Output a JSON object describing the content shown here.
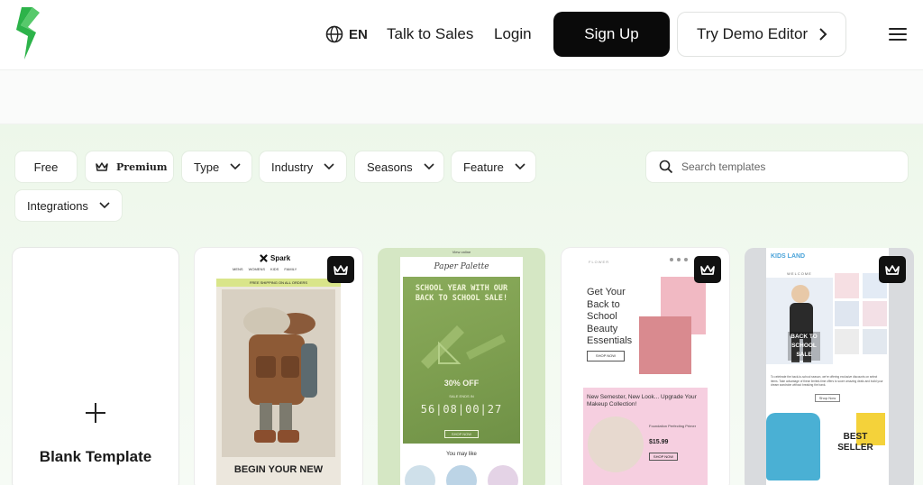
{
  "header": {
    "lang_label": "EN",
    "talk_to_sales": "Talk to Sales",
    "login": "Login",
    "sign_up": "Sign Up",
    "try_demo": "Try Demo Editor"
  },
  "filters": {
    "free": "Free",
    "premium": "Premium",
    "type": "Type",
    "industry": "Industry",
    "seasons": "Seasons",
    "feature": "Feature",
    "integrations": "Integrations",
    "search_placeholder": "Search templates"
  },
  "templates": {
    "blank": {
      "label": "Blank Template"
    },
    "spark": {
      "brand": "Spark",
      "nav": [
        "MENS",
        "WOMENS",
        "KIDS",
        "FAMILY"
      ],
      "shipping": "FREE SHIPPING ON ALL ORDERS",
      "headline": "BEGIN YOUR NEW"
    },
    "paper": {
      "view_online": "View online",
      "brand": "Paper Palette",
      "title": "SCHOOL YEAR WITH OUR BACK TO SCHOOL SALE!",
      "offer": "30% OFF",
      "ends": "SALE ENDS IN",
      "timer": "56|08|00|27",
      "shop": "SHOP NOW",
      "like": "You may like"
    },
    "flower": {
      "brand": "FLOWER",
      "title": "Get Your Back to School Beauty Essentials",
      "btn": "SHOP NOW",
      "promo": "New Semester, New Look... Upgrade Your Makeup Collection!",
      "product": "Foundation Perfecting Primer",
      "price": "$15.99",
      "shop": "SHOP NOW"
    },
    "kids": {
      "brand": "KIDS LAND",
      "welcome": "WELCOME",
      "hero_text": "BACK TO SCHOOL SALE",
      "para": "To celebrate the back-to-school season, we're offering exclusive discounts on select items. Take advantage of these limited-time offers to score amazing deals and build your dream wardrobe without breaking the bank.",
      "shop": "Shop Now",
      "best": "BEST SELLER"
    }
  },
  "colors": {
    "accent_green": "#2db34a",
    "filter_bg": "#edf7ea",
    "signup_bg": "#0a0a0a"
  }
}
